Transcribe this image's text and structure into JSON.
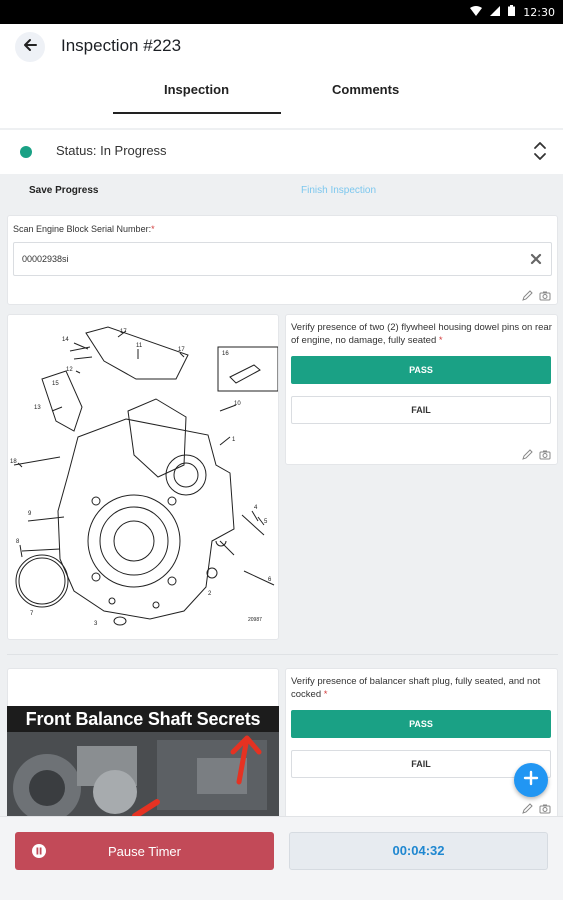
{
  "statusbar": {
    "time": "12:30"
  },
  "header": {
    "title": "Inspection #223"
  },
  "tabs": [
    {
      "label": "Inspection",
      "active": true
    },
    {
      "label": "Comments",
      "active": false
    }
  ],
  "status": {
    "text": "Status: In Progress",
    "color": "#1aa185"
  },
  "actions": {
    "save": "Save Progress",
    "finish": "Finish Inspection"
  },
  "serial_field": {
    "label": "Scan Engine Block Serial Number:",
    "required_mark": "*",
    "value": "00002938si"
  },
  "questions": [
    {
      "text": "Verify presence of two (2) flywheel housing dowel pins on rear of engine, no damage, fully seated",
      "required_mark": "*",
      "pass_label": "PASS",
      "fail_label": "FAIL",
      "diagram_id": "20987",
      "callouts": [
        "14",
        "17",
        "11",
        "12",
        "13",
        "15",
        "16",
        "10",
        "1",
        "18",
        "9",
        "8",
        "4",
        "5",
        "6",
        "2",
        "3",
        "7"
      ]
    },
    {
      "text": "Verify presence of balancer shaft plug, fully seated, and not cocked",
      "required_mark": "*",
      "pass_label": "PASS",
      "fail_label": "FAIL",
      "video_title": "Front Balance Shaft Secrets"
    }
  ],
  "footer": {
    "pause_label": "Pause Timer",
    "timer": "00:04:32"
  },
  "colors": {
    "accent": "#1aa185",
    "danger": "#c24a58",
    "link": "#1f87d0",
    "fab": "#2196f3"
  }
}
